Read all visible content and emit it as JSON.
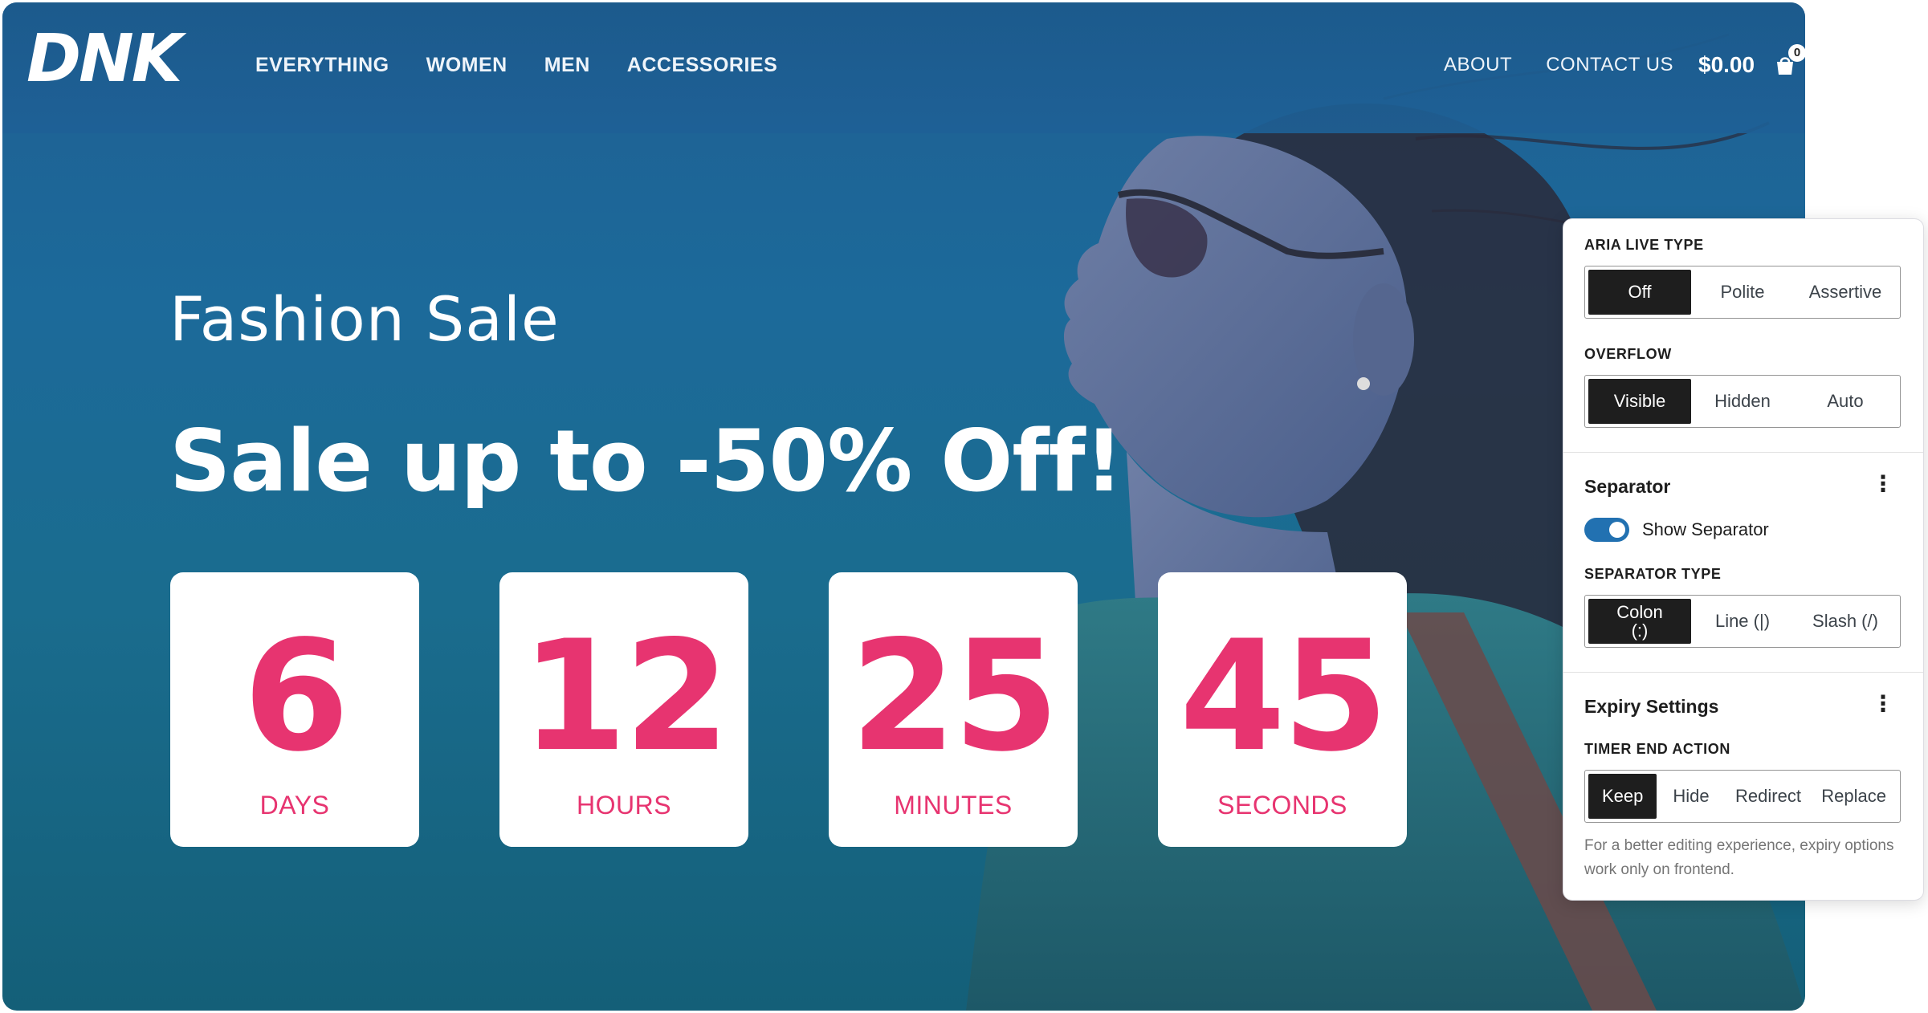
{
  "header": {
    "logo_text": "DNK",
    "nav_left": [
      "EVERYTHING",
      "WOMEN",
      "MEN",
      "ACCESSORIES"
    ],
    "nav_right": [
      "ABOUT",
      "CONTACT US"
    ],
    "cart_total": "$0.00",
    "cart_count": "0"
  },
  "hero": {
    "subtitle": "Fashion Sale",
    "headline": "Sale up to -50% Off!",
    "countdown": [
      {
        "value": "6",
        "label": "DAYS"
      },
      {
        "value": "12",
        "label": "HOURS"
      },
      {
        "value": "25",
        "label": "MINUTES"
      },
      {
        "value": "45",
        "label": "SECONDS"
      }
    ],
    "accent_color": "#e73470"
  },
  "panel": {
    "aria_live": {
      "label": "ARIA LIVE TYPE",
      "options": [
        "Off",
        "Polite",
        "Assertive"
      ],
      "selected": "Off"
    },
    "overflow": {
      "label": "OVERFLOW",
      "options": [
        "Visible",
        "Hidden",
        "Auto"
      ],
      "selected": "Visible"
    },
    "separator": {
      "title": "Separator",
      "toggle_label": "Show Separator",
      "toggle_on": true,
      "type_label": "SEPARATOR TYPE",
      "options": [
        "Colon\n(:)",
        "Line (|)",
        "Slash (/)"
      ],
      "selected": "Colon\n(:)"
    },
    "expiry": {
      "title": "Expiry Settings",
      "action_label": "TIMER END ACTION",
      "options": [
        "Keep",
        "Hide",
        "Redirect",
        "Replace"
      ],
      "selected": "Keep",
      "help": "For a better editing experience, expiry options work only on frontend."
    }
  }
}
